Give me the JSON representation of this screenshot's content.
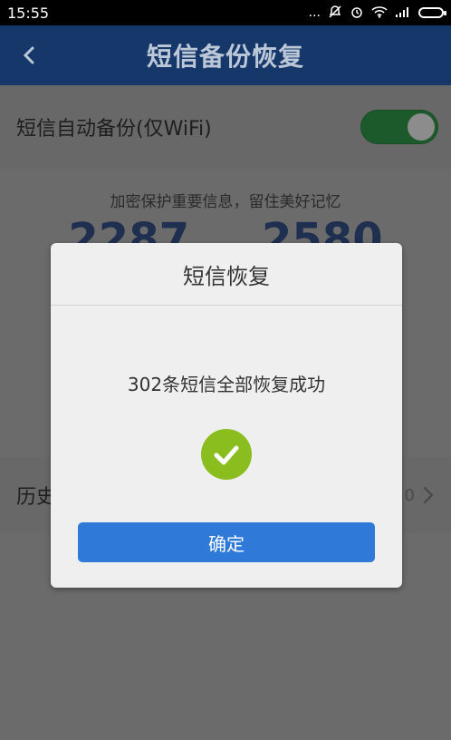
{
  "status_bar": {
    "time": "15:55",
    "dots": "...",
    "icons": [
      "mute-icon",
      "alarm-icon",
      "wifi-icon",
      "signal-icon",
      "battery-icon"
    ]
  },
  "header": {
    "title": "短信备份恢复",
    "back_icon": "chevron-left-icon"
  },
  "settings": {
    "auto_backup_label": "短信自动备份(仅WiFi)",
    "auto_backup_enabled": true
  },
  "content": {
    "slogan": "加密保护重要信息，留住美好记忆",
    "left_count_peek": "2287",
    "right_count_peek": "2580"
  },
  "history": {
    "label_partial": "历史",
    "right_text_partial": "0"
  },
  "dialog": {
    "title": "短信恢复",
    "message": "302条短信全部恢复成功",
    "confirm_label": "确定",
    "success_icon": "checkmark-circle-icon"
  },
  "colors": {
    "header_bg": "#16376a",
    "overlay_gray": "#6b6b6b",
    "toggle_on": "#1d5a2b",
    "success_green": "#8abd1e",
    "primary_blue": "#2f7ad8"
  }
}
